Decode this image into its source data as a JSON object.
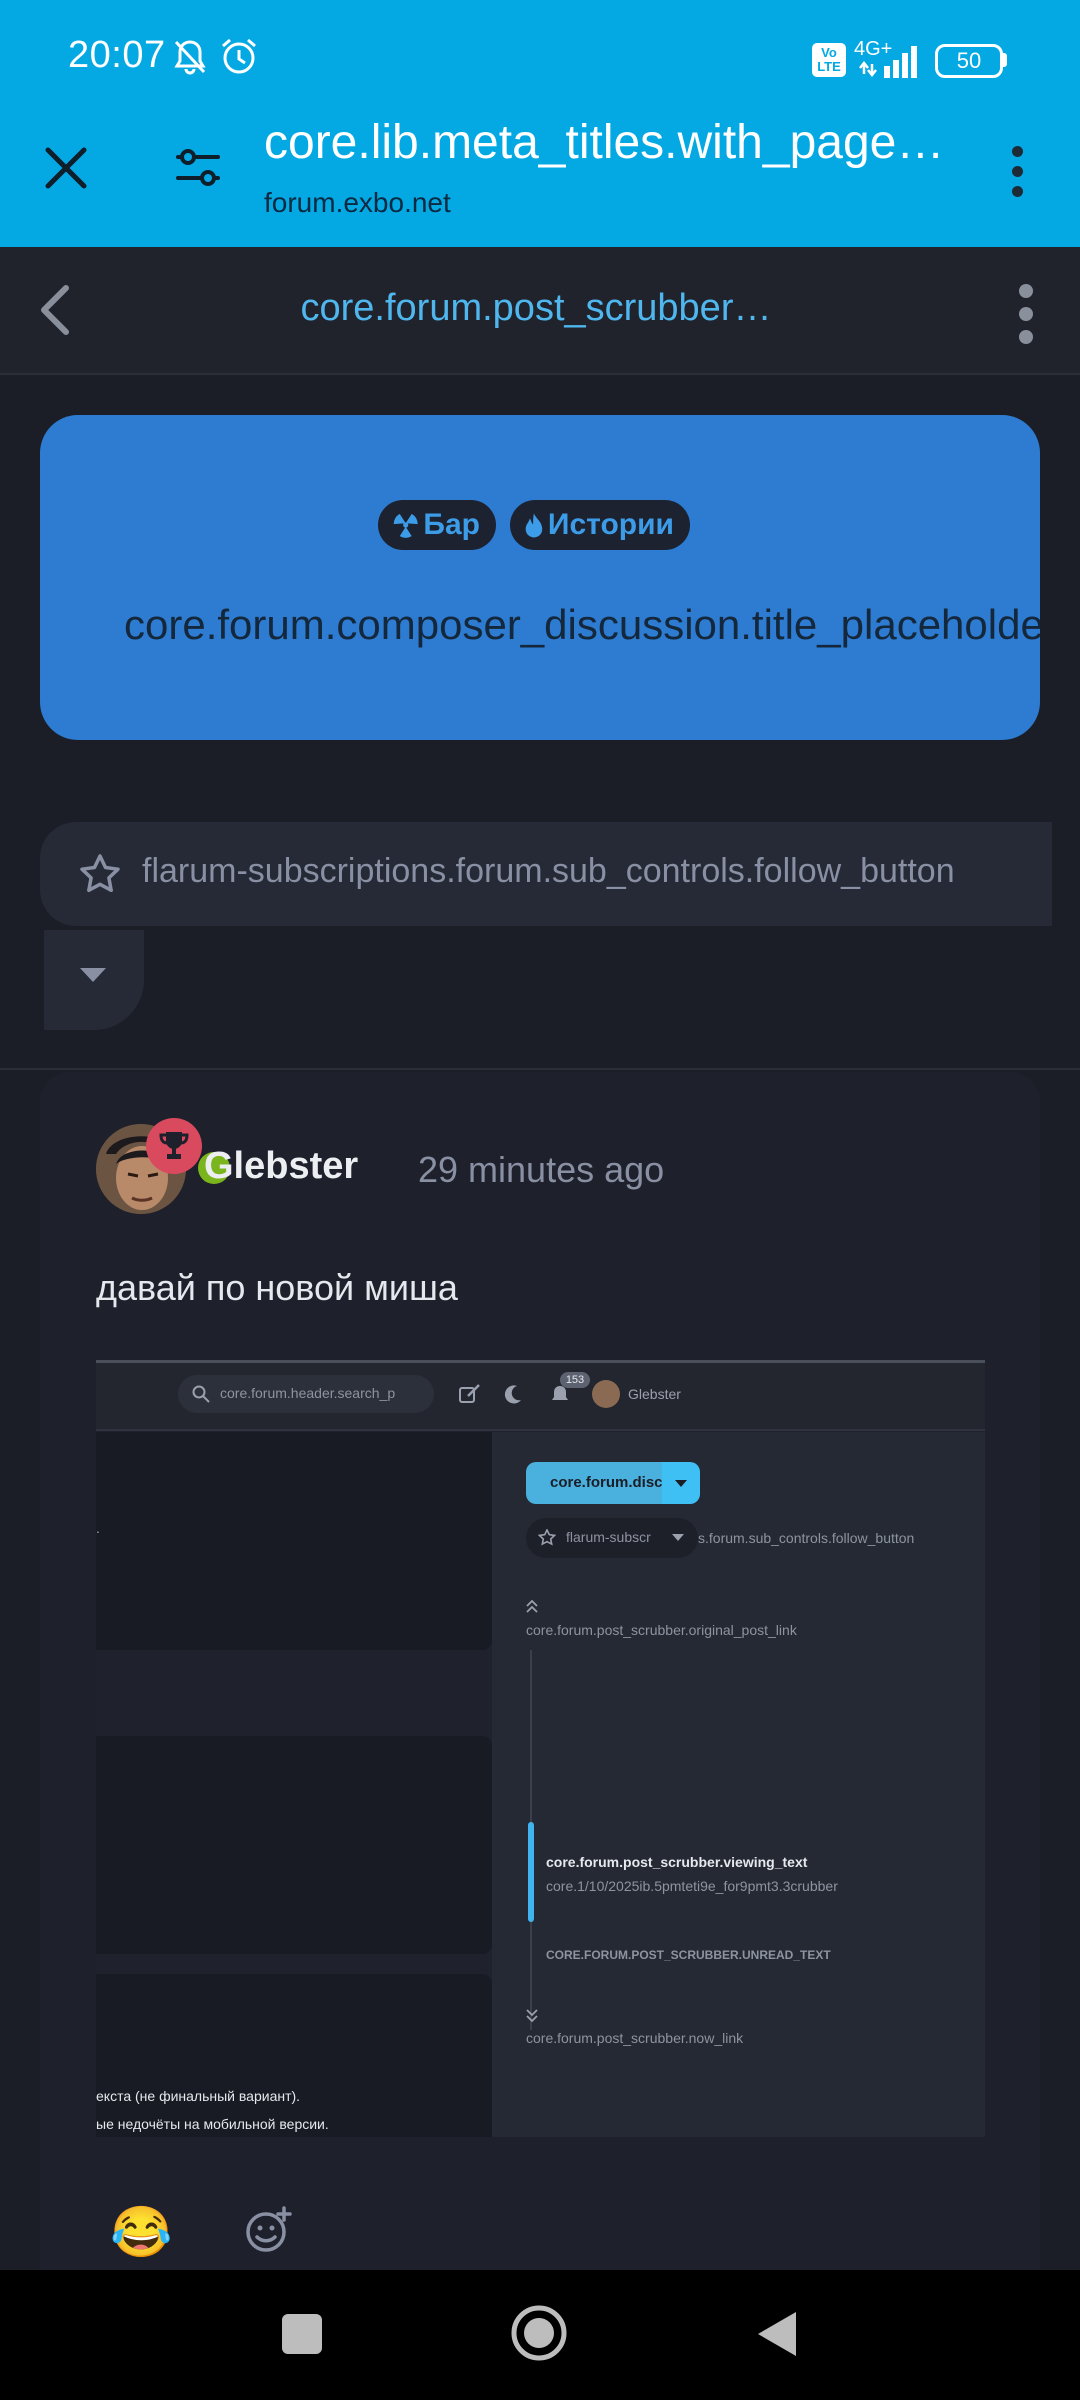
{
  "status_bar": {
    "time": "20:07",
    "network": "4G+",
    "volte": "Vo LTE",
    "battery": "50",
    "icons": [
      "bell-muted-icon",
      "alarm-icon",
      "signal-icon"
    ]
  },
  "browser": {
    "title": "core.lib.meta_titles.with_page…",
    "domain": "forum.exbo.net"
  },
  "forum_header": {
    "title": "core.forum.post_scrubber…"
  },
  "hero": {
    "tags": [
      {
        "label": "Бар",
        "icon": "radiation-icon"
      },
      {
        "label": "Истории",
        "icon": "flame-icon"
      }
    ],
    "title": "core.forum.composer_discussion.title_placeholder"
  },
  "follow": {
    "label": "flarum-subscriptions.forum.sub_controls.follow_button"
  },
  "post": {
    "author": "Glebster",
    "time": "29 minutes ago",
    "body": "давай по новой миша",
    "reactions": [
      "😂"
    ]
  },
  "embedded_screenshot": {
    "search_placeholder": "core.forum.header.search_p",
    "notification_count": "153",
    "username": "Glebster",
    "primary_button": "core.forum.disc",
    "follow_button": "flarum-subscr",
    "follow_button_tail": "s.forum.sub_controls.follow_button",
    "original_post_link": "core.forum.post_scrubber.original_post_link",
    "viewing_text": "core.forum.post_scrubber.viewing_text",
    "viewing_sub": "core.1/10/2025ib.5pmteti9e_for9pmt3.3crubber",
    "unread_text": "CORE.FORUM.POST_SCRUBBER.UNREAD_TEXT",
    "now_link": "core.forum.post_scrubber.now_link",
    "line1": "екста (не финальный вариант).",
    "line2": "ые недочёты на мобильной версии.",
    "dot": "."
  },
  "colors": {
    "browser_bar": "#04a9e3",
    "hero": "#2d7cd1",
    "page_bg": "#1b1e27",
    "accent": "#4fb7ee",
    "online": "#7ab51d",
    "badge": "#d94a5f"
  }
}
